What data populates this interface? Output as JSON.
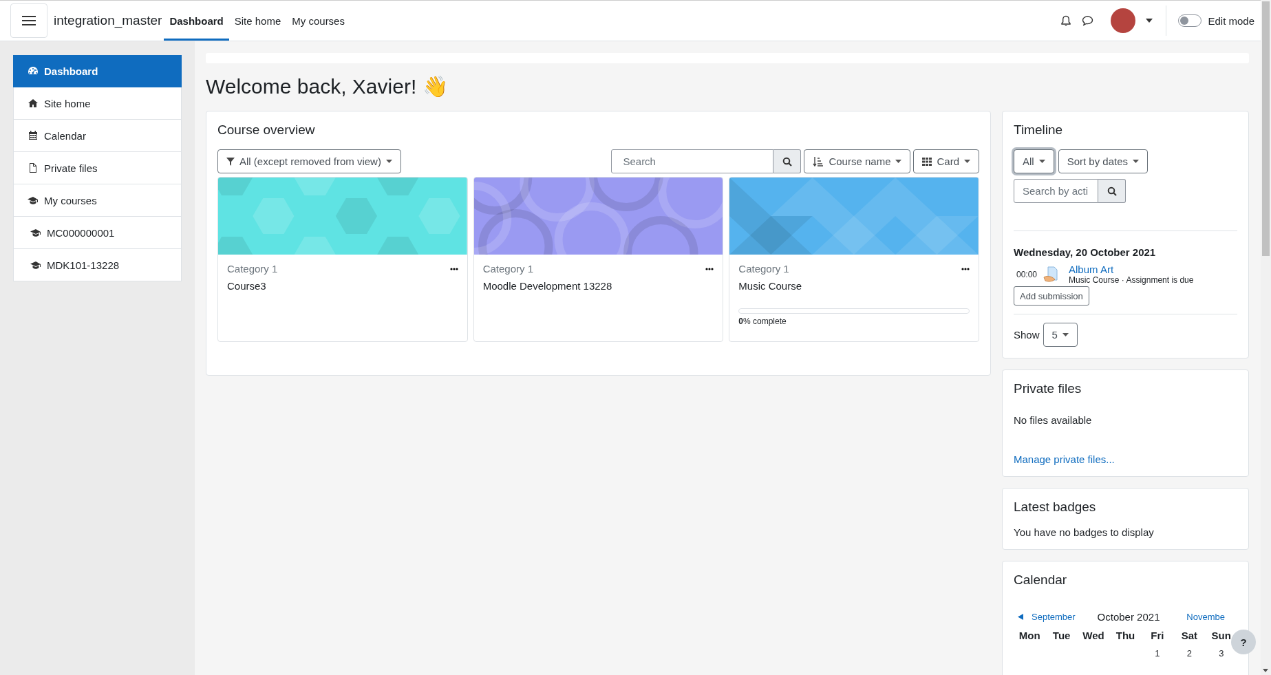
{
  "navbar": {
    "brand": "integration_master",
    "links": [
      {
        "label": "Dashboard",
        "selected": true
      },
      {
        "label": "Site home",
        "selected": false
      },
      {
        "label": "My courses",
        "selected": false
      }
    ],
    "edit_mode": {
      "label": "Edit mode",
      "on": false
    }
  },
  "sidebar": {
    "items": [
      {
        "label": "Dashboard",
        "kind": "gauge",
        "selected": true
      },
      {
        "label": "Site home",
        "kind": "home",
        "selected": false
      },
      {
        "label": "Calendar",
        "kind": "calendar",
        "selected": false
      },
      {
        "label": "Private files",
        "kind": "file",
        "selected": false
      },
      {
        "label": "My courses",
        "kind": "cap",
        "selected": false,
        "children": [
          {
            "label": "MC000000001",
            "kind": "cap",
            "selected": false
          },
          {
            "label": "MDK101-13228",
            "kind": "cap",
            "selected": false
          }
        ]
      }
    ]
  },
  "heading": "Welcome back, Xavier! 👋",
  "course_overview": {
    "title": "Course overview",
    "filter": "All (except removed from view)",
    "search": {
      "placeholder": "Search"
    },
    "sort": "Course name",
    "view": "Card",
    "courses": [
      {
        "category": "Category 1",
        "name": "Course3",
        "kind": "hexagons",
        "color": "#5fe3e3"
      },
      {
        "category": "Category 1",
        "name": "Moodle Development 13228",
        "kind": "circles",
        "color": "#9a9af2"
      },
      {
        "category": "Category 1",
        "name": "Music Course",
        "kind": "triangles",
        "color": "#55b3ee",
        "progress": {
          "level": 0,
          "text": "**0**% complete"
        }
      }
    ]
  },
  "timeline": {
    "title": "Timeline",
    "filter": "All",
    "sort": "Sort by dates",
    "search": {
      "placeholder": "Search by acti"
    },
    "date": "Wednesday, 20 October 2021",
    "events": [
      {
        "time": "00:00",
        "name": "Album Art",
        "detail": "Music Course · Assignment is due",
        "action": "Add submission"
      }
    ],
    "show_label": "Show",
    "show_value": "5"
  },
  "private_files": {
    "title": "Private files",
    "empty": "No files available",
    "link": "Manage private files..."
  },
  "latest_badges": {
    "title": "Latest badges",
    "empty": "You have no badges to display"
  },
  "calendar": {
    "title": "Calendar",
    "prev": "September",
    "month": "October 2021",
    "next": "Novembe",
    "weekdays": [
      "Mon",
      "Tue",
      "Wed",
      "Thu",
      "Fri",
      "Sat",
      "Sun"
    ],
    "first_week": [
      "1",
      "2",
      "3"
    ]
  },
  "help": "?"
}
